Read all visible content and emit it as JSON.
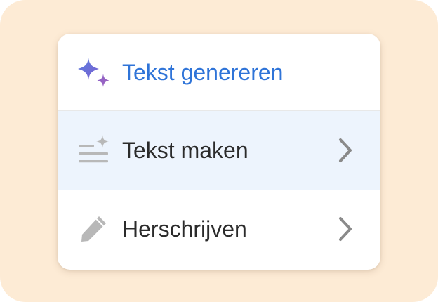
{
  "colors": {
    "backdrop": "#fdebd5",
    "header_text": "#2f74d8",
    "hover_row": "#edf4fd",
    "icon_grey": "#b8b8b8",
    "chevron_grey": "#8a8a8a"
  },
  "menu": {
    "header": {
      "label": "Tekst genereren",
      "icon": "sparkle-icon"
    },
    "items": [
      {
        "label": "Tekst maken",
        "icon": "text-sparkle-icon",
        "submenu": true,
        "highlighted": true
      },
      {
        "label": "Herschrijven",
        "icon": "pencil-icon",
        "submenu": true,
        "highlighted": false
      }
    ]
  }
}
